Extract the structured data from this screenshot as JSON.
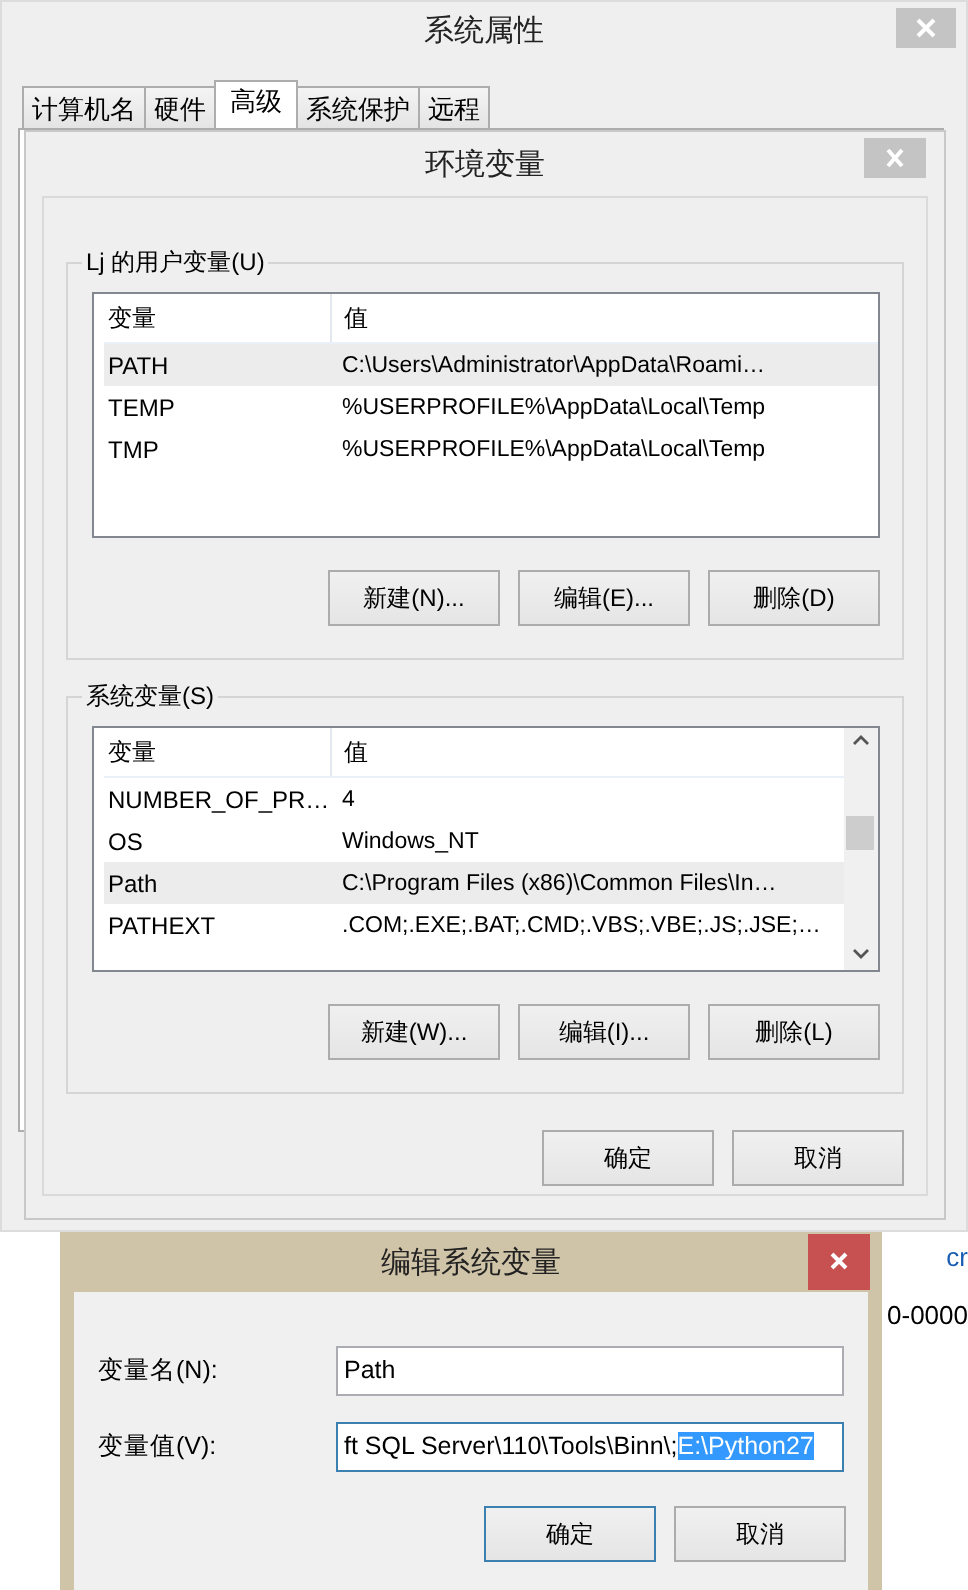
{
  "system_properties": {
    "title": "系统属性",
    "tabs": [
      {
        "label": "计算机名",
        "selected": false
      },
      {
        "label": "硬件",
        "selected": false
      },
      {
        "label": "高级",
        "selected": true
      },
      {
        "label": "系统保护",
        "selected": false
      },
      {
        "label": "远程",
        "selected": false
      }
    ]
  },
  "env_dialog": {
    "title": "环境变量",
    "groups": [
      {
        "label": "Lj 的用户变量(U)",
        "columns": [
          "变量",
          "值"
        ],
        "scrollbar": false,
        "rows": [
          {
            "name": "PATH",
            "value": "C:\\Users\\Administrator\\AppData\\Roami…",
            "selected": true
          },
          {
            "name": "TEMP",
            "value": "%USERPROFILE%\\AppData\\Local\\Temp",
            "selected": false
          },
          {
            "name": "TMP",
            "value": "%USERPROFILE%\\AppData\\Local\\Temp",
            "selected": false
          }
        ],
        "buttons": [
          "新建(N)...",
          "编辑(E)...",
          "删除(D)"
        ]
      },
      {
        "label": "系统变量(S)",
        "columns": [
          "变量",
          "值"
        ],
        "scrollbar": true,
        "rows": [
          {
            "name": "NUMBER_OF_PR…",
            "value": "4",
            "selected": false
          },
          {
            "name": "OS",
            "value": "Windows_NT",
            "selected": false
          },
          {
            "name": "Path",
            "value": "C:\\Program Files (x86)\\Common Files\\In…",
            "selected": true
          },
          {
            "name": "PATHEXT",
            "value": ".COM;.EXE;.BAT;.CMD;.VBS;.VBE;.JS;.JSE;…",
            "selected": false
          }
        ],
        "buttons": [
          "新建(W)...",
          "编辑(I)...",
          "删除(L)"
        ]
      }
    ],
    "buttons": [
      "确定",
      "取消"
    ]
  },
  "edit_dialog": {
    "title": "编辑系统变量",
    "name_label": "变量名(N):",
    "name_value": "Path",
    "value_label": "变量值(V):",
    "value_text": "ft SQL Server\\110\\Tools\\Binn\\;",
    "value_selection": "E:\\Python27",
    "value_focused": true,
    "buttons": [
      {
        "label": "确定",
        "default": true
      },
      {
        "label": "取消",
        "default": false
      }
    ]
  },
  "background_fragments": [
    {
      "text": "cr",
      "kind": "link"
    },
    {
      "text": "0-0000",
      "kind": "text"
    }
  ]
}
